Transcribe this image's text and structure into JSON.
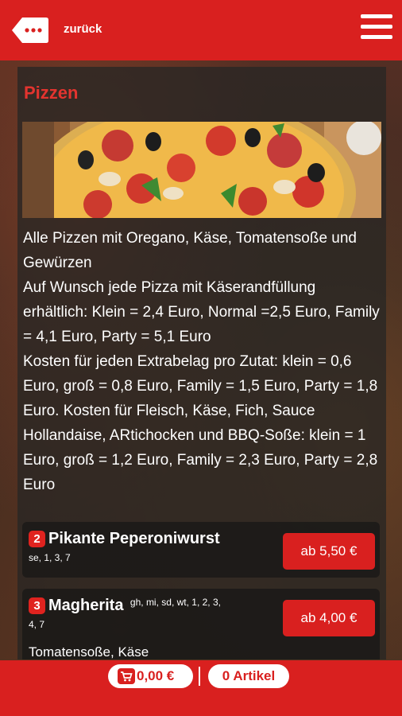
{
  "header": {
    "back_label": "zurück"
  },
  "section": {
    "title": "Pizzen"
  },
  "description": [
    "Alle Pizzen mit Oregano, Käse, Tomatensoße und Gewürzen",
    "Auf Wunsch jede Pizza mit Käserandfüllung erhältlich: Klein = 2,4 Euro, Normal =2,5 Euro, Family = 4,1 Euro, Party = 5,1 Euro",
    "Kosten für jeden Extrabelag pro Zutat: klein = 0,6 Euro, groß = 0,8 Euro, Family = 1,5 Euro, Party = 1,8 Euro. Kosten für Fleisch, Käse, Fich, Sauce Hollandaise, ARtichocken und BBQ-Soße: klein = 1 Euro, groß = 1,2 Euro, Family = 2,3 Euro, Party = 2,8 Euro"
  ],
  "items": [
    {
      "number": "2",
      "name": "Pikante Peperoniwurst",
      "tags": "se, 1, 3, 7",
      "price": "ab 5,50 €",
      "desc": ""
    },
    {
      "number": "3",
      "name": "Magherita",
      "tags": "gh, mi, sd, wt, 1, 2, 3,",
      "tags2": "4, 7",
      "price": "ab 4,00 €",
      "desc": "Tomatensoße, Käse"
    }
  ],
  "footer": {
    "total": "0,00 €",
    "articles": "0 Artikel"
  },
  "colors": {
    "brand_red": "#d9201f",
    "title_red": "#e3342f"
  }
}
